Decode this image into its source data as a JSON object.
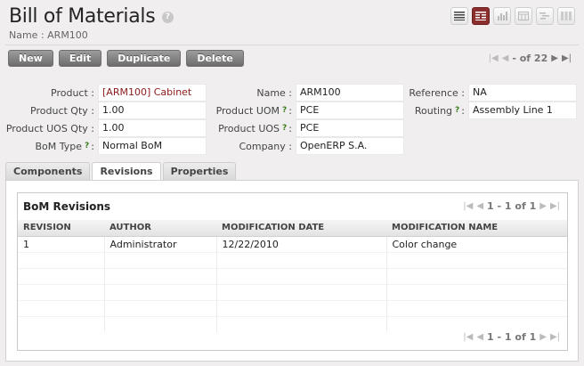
{
  "header": {
    "title": "Bill of Materials",
    "help": "?",
    "subtitle": "Name : ARM100"
  },
  "view_switch": [
    {
      "name": "list-view-icon",
      "active": false
    },
    {
      "name": "form-view-icon",
      "active": true
    },
    {
      "name": "graph-view-icon",
      "active": false
    },
    {
      "name": "calendar-view-icon",
      "active": false
    },
    {
      "name": "gantt-view-icon",
      "active": false
    },
    {
      "name": "kanban-view-icon",
      "active": false
    }
  ],
  "toolbar": {
    "new": "New",
    "edit": "Edit",
    "duplicate": "Duplicate",
    "delete": "Delete"
  },
  "pager": {
    "count": "- of 22"
  },
  "form": {
    "product_label": "Product :",
    "product_value": "[ARM100] Cabinet",
    "product_qty_label": "Product Qty :",
    "product_qty_value": "1.00",
    "product_uos_qty_label": "Product UOS Qty :",
    "product_uos_qty_value": "1.00",
    "bom_type_label": "BoM Type",
    "bom_type_value": "Normal BoM",
    "name_label": "Name :",
    "name_value": "ARM100",
    "product_uom_label": "Product UOM",
    "product_uom_value": "PCE",
    "product_uos_label": "Product UOS",
    "product_uos_value": "PCE",
    "company_label": "Company :",
    "company_value": "OpenERP S.A.",
    "reference_label": "Reference :",
    "reference_value": "NA",
    "routing_label": "Routing",
    "routing_value": "Assembly Line 1",
    "help_mark": "?",
    "colon": ":"
  },
  "tabs": {
    "components": "Components",
    "revisions": "Revisions",
    "properties": "Properties"
  },
  "revisions": {
    "title": "BoM Revisions",
    "pager_count": "1 - 1 of 1",
    "columns": [
      "REVISION",
      "AUTHOR",
      "MODIFICATION DATE",
      "MODIFICATION NAME"
    ],
    "rows": [
      {
        "revision": "1",
        "author": "Administrator",
        "date": "12/22/2010",
        "name": "Color change"
      }
    ]
  }
}
